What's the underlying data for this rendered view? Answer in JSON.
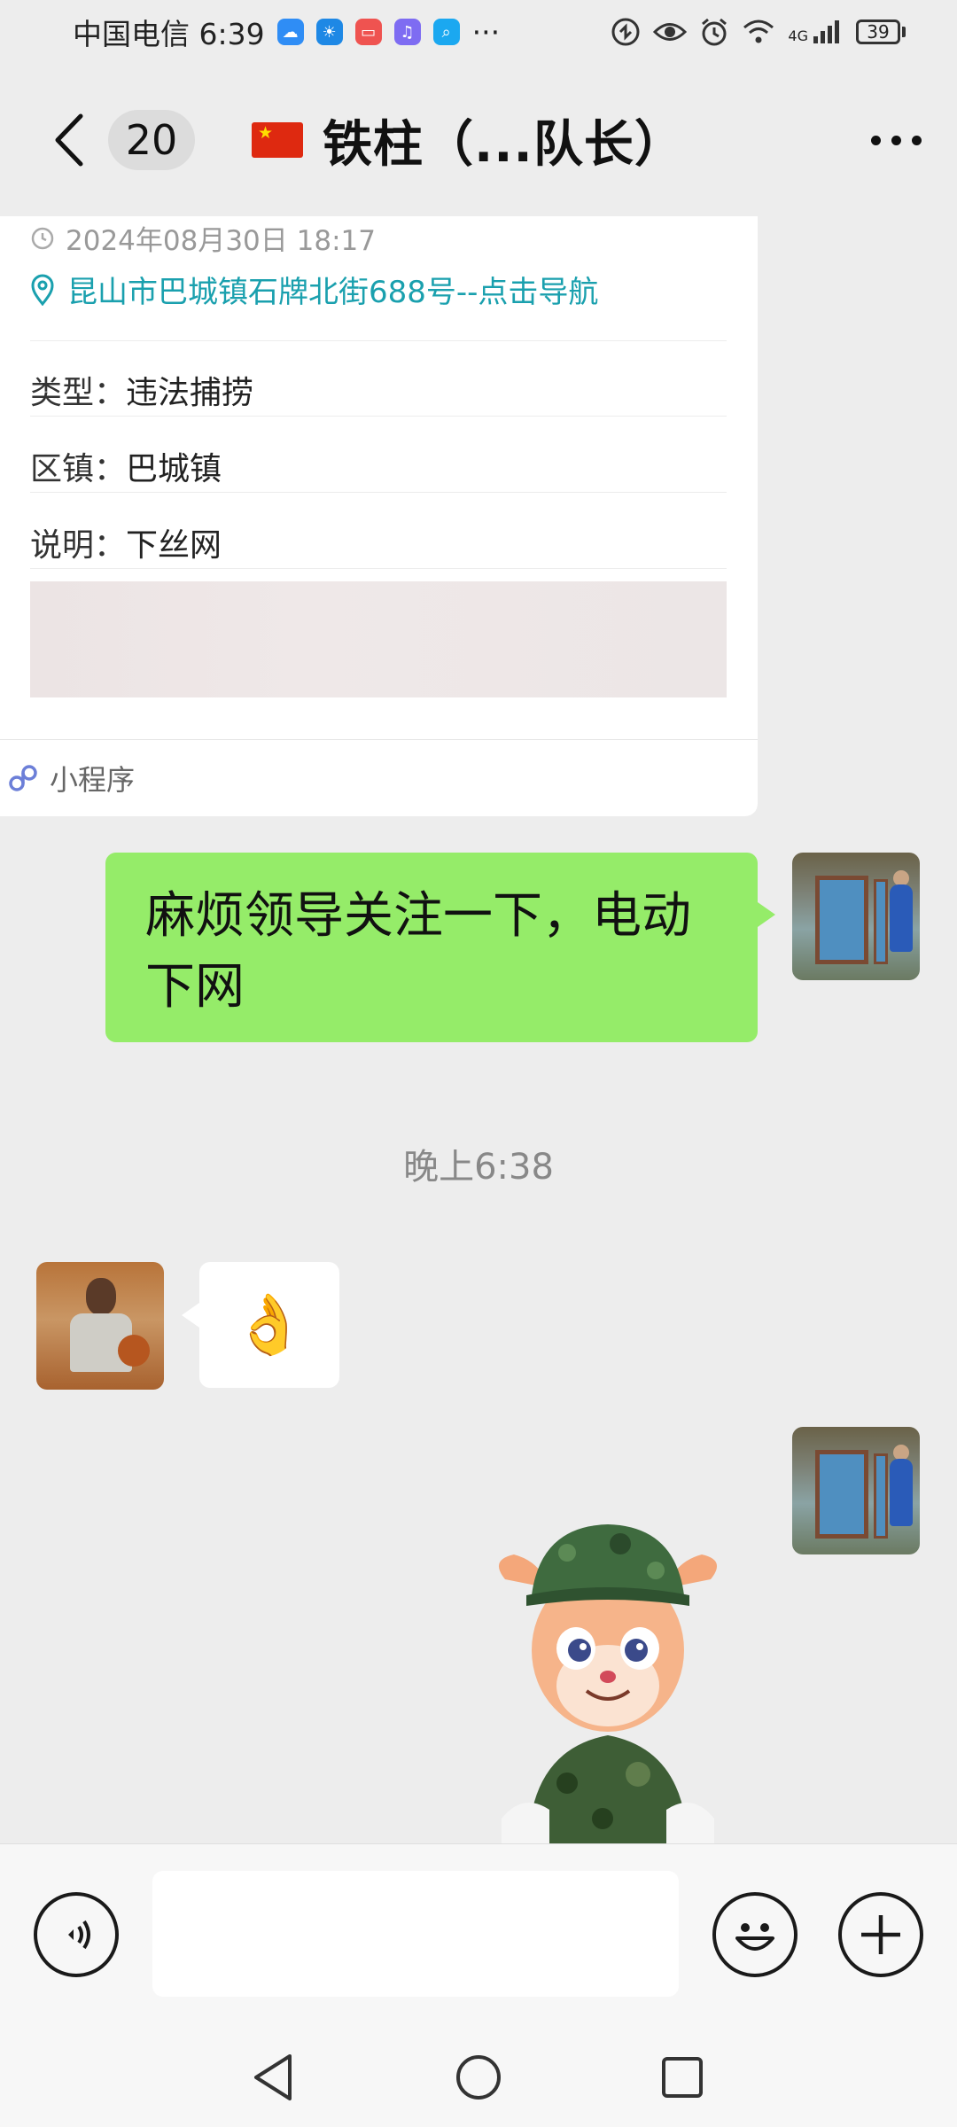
{
  "status_bar": {
    "carrier_time": "中国电信 6:39",
    "more_notifications": "···",
    "network_type": "4G",
    "battery_level": "39"
  },
  "nav": {
    "unread_count": "20",
    "title": "铁柱（...队长）"
  },
  "card": {
    "datetime": "2024年08月30日 18:17",
    "address_link": "昆山市巴城镇石牌北街688号--点击导航",
    "fields": [
      {
        "key": "类型：",
        "value": "违法捕捞"
      },
      {
        "key": "区镇：",
        "value": "巴城镇"
      },
      {
        "key": "说明：",
        "value": "下丝网"
      }
    ],
    "footer_label": "小程序"
  },
  "messages": {
    "outgoing_text": "麻烦领导关注一下，电动下网",
    "time_separator": "晚上6:38",
    "incoming_emoji": "👌"
  },
  "input_bar": {
    "placeholder": ""
  },
  "colors": {
    "bubble_me": "#95ec69",
    "link": "#1aa0ae",
    "background": "#ededed"
  }
}
